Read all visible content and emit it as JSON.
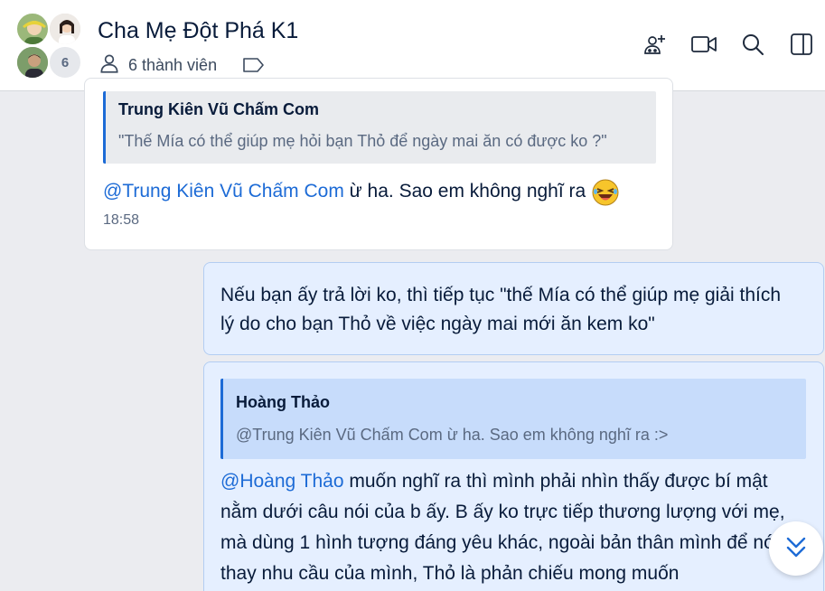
{
  "header": {
    "title": "Cha Mẹ Đột Phá K1",
    "member_count_label": "6 thành viên",
    "extra_members_badge": "6"
  },
  "messages": {
    "incoming": {
      "quote_author": "Trung Kiên Vũ Chấm Com",
      "quote_text": "\"Thế Mía có thể giúp mẹ hỏi bạn Thỏ để ngày mai ăn có được ko ?\"",
      "mention": "@Trung Kiên Vũ Chấm Com",
      "text": " ừ ha. Sao em không nghĩ ra",
      "time": "18:58"
    },
    "outgoing_1": {
      "text": "Nếu bạn ấy trả lời ko, thì tiếp tục \"thế Mía có thể giúp mẹ giải thích lý do cho bạn Thỏ về việc ngày mai mới ăn kem ko\""
    },
    "outgoing_2": {
      "quote_author": "Hoàng Thảo",
      "quote_text": "@Trung Kiên Vũ Chấm Com ừ ha. Sao em không nghĩ ra :>",
      "mention": "@Hoàng Thảo",
      "text": " muốn nghĩ ra thì mình phải nhìn thấy được bí mật nằm dưới câu nói của b ấy. B ấy ko trực tiếp thương lượng với mẹ, mà dùng 1 hình tượng đáng yêu khác, ngoài bản thân mình để nói thay nhu cầu của mình, Thỏ là phản chiếu mong muốn"
    }
  },
  "colors": {
    "accent": "#1d6bd6",
    "outgoing_bg": "#e5efff",
    "quote_out_bg": "#c7dcfb",
    "canvas_bg": "#ebecf0"
  },
  "icons": [
    "add-member-icon",
    "video-call-icon",
    "search-icon",
    "sidebar-toggle-icon",
    "members-icon",
    "tag-icon",
    "scroll-down-icon",
    "laughing-emoji-icon"
  ]
}
